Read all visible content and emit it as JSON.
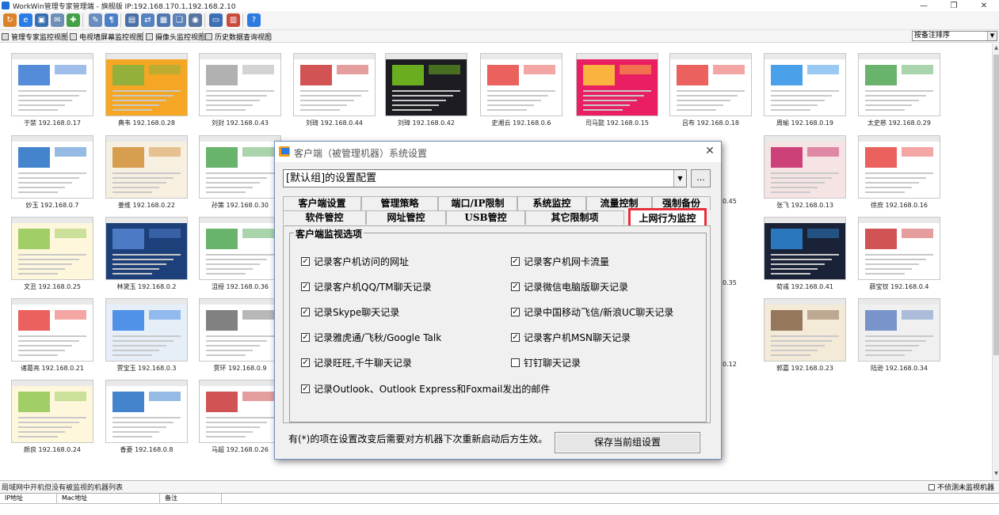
{
  "window": {
    "title": "WorkWin管理专家管理端 - 旗舰版 IP:192.168.170.1,192.168.2.10",
    "minimize": "—",
    "restore": "❐",
    "close": "✕"
  },
  "toolbar_icons": [
    {
      "name": "refresh-icon",
      "color": "#d9822b",
      "glyph": "↻"
    },
    {
      "name": "ie-browser-icon",
      "color": "#2a7be4",
      "glyph": "e"
    },
    {
      "name": "monitor-settings-icon",
      "color": "#3a6fb0",
      "glyph": "▣"
    },
    {
      "name": "mail-icon",
      "color": "#6d8fb5",
      "glyph": "✉"
    },
    {
      "name": "plugin-icon",
      "color": "#43a047",
      "glyph": "✚"
    },
    {
      "name": "wrench-icon",
      "color": "#6a8cc0",
      "glyph": "✎"
    },
    {
      "name": "policy-icon",
      "color": "#4a7fc7",
      "glyph": "¶"
    },
    {
      "name": "screen-icon",
      "color": "#4b6fa6",
      "glyph": "▤"
    },
    {
      "name": "network-icon",
      "color": "#5582c0",
      "glyph": "⇄"
    },
    {
      "name": "report-icon",
      "color": "#4f78b0",
      "glyph": "▦"
    },
    {
      "name": "copy-icon",
      "color": "#5b82b8",
      "glyph": "❏"
    },
    {
      "name": "disk-icon",
      "color": "#5973a0",
      "glyph": "◉"
    },
    {
      "name": "notepad-icon",
      "color": "#3d6fb6",
      "glyph": "▭"
    },
    {
      "name": "calendar-icon",
      "color": "#c94a3b",
      "glyph": "▥"
    },
    {
      "name": "help-icon",
      "color": "#2d7be0",
      "glyph": "?"
    }
  ],
  "view_tabs": [
    {
      "label": "管理专家监控视图"
    },
    {
      "label": "电视墙屏幕监控视图"
    },
    {
      "label": "摄像头监控视图"
    },
    {
      "label": "历史数据查询视图"
    }
  ],
  "sort_select": {
    "value": "按备注排序",
    "arrow": "▼"
  },
  "scrollbar": {
    "up": "▲",
    "down": "▼"
  },
  "thumbnails": [
    {
      "caption": "于禁 192.168.0.17",
      "theme": "#ffffff",
      "accent": "#2b6fd1"
    },
    {
      "caption": "典韦 192.168.0.28",
      "theme": "#f5a623",
      "accent": "#7cb342"
    },
    {
      "caption": "刘封 192.168.0.43",
      "theme": "#ffffff",
      "accent": "#9e9e9e"
    },
    {
      "caption": "刘琦 192.168.0.44",
      "theme": "#ffffff",
      "accent": "#c62828"
    },
    {
      "caption": "刘璋 192.168.0.42",
      "theme": "#1c1c22",
      "accent": "#7ed321"
    },
    {
      "caption": "史湘云 192.168.0.6",
      "theme": "#ffffff",
      "accent": "#e53935"
    },
    {
      "caption": "司马懿 192.168.0.15",
      "theme": "#e91e63",
      "accent": "#fdd835"
    },
    {
      "caption": "吕布 192.168.0.18",
      "theme": "#ffffff",
      "accent": "#e53935"
    },
    {
      "caption": "周瑜 192.168.0.19",
      "theme": "#ffffff",
      "accent": "#1e88e5"
    },
    {
      "caption": "太史慈 192.168.0.29",
      "theme": "#ffffff",
      "accent": "#43a047"
    },
    {
      "caption": "妙玉 192.168.0.7",
      "theme": "#ffffff",
      "accent": "#1565c0"
    },
    {
      "caption": "姜维 192.168.0.22",
      "theme": "#f7efe0",
      "accent": "#d08a2c"
    },
    {
      "caption": "孙策 192.168.0.30",
      "theme": "#ffffff",
      "accent": "#43a047"
    },
    {
      "caption": "张飞 192.168.0.13",
      "theme": "#f6e4e4",
      "accent": "#c2185b"
    },
    {
      "caption": "徐庶 192.168.0.16",
      "theme": "#ffffff",
      "accent": "#e53935"
    },
    {
      "caption": "文丑 192.168.0.25",
      "theme": "#fff7dc",
      "accent": "#8bc34a"
    },
    {
      "caption": "林黛玉 192.168.0.2",
      "theme": "#1d3f7a",
      "accent": "#5a8ad8"
    },
    {
      "caption": "沮授 192.168.0.36",
      "theme": "#ffffff",
      "accent": "#43a047"
    },
    {
      "caption": "荀彧 192.168.0.41",
      "theme": "#1a2238",
      "accent": "#2e8de0"
    },
    {
      "caption": "薛宝钗 192.168.0.4",
      "theme": "#ffffff",
      "accent": "#c62828"
    },
    {
      "caption": "诸葛亮 192.168.0.21",
      "theme": "#ffffff",
      "accent": "#e53935"
    },
    {
      "caption": "贾宝玉 192.168.0.3",
      "theme": "#e6eef8",
      "accent": "#2a7be4"
    },
    {
      "caption": "贾环 192.168.0.9",
      "theme": "#ffffff",
      "accent": "#616161"
    },
    {
      "caption": "郭嘉 192.168.0.23",
      "theme": "#f3ead8",
      "accent": "#7d5a3c"
    },
    {
      "caption": "陆逊 192.168.0.34",
      "theme": "#f0f0f0",
      "accent": "#5b7cc2"
    },
    {
      "caption": "颜良 192.168.0.24",
      "theme": "#fff7dc",
      "accent": "#8bc34a"
    },
    {
      "caption": "香菱 192.168.0.8",
      "theme": "#ffffff",
      "accent": "#1565c0"
    },
    {
      "caption": "马超 192.168.0.26",
      "theme": "#ffffff",
      "accent": "#c62828"
    }
  ],
  "partial_captions": [
    {
      "text": "0.45"
    },
    {
      "text": "0.35"
    },
    {
      "text": "0.12"
    }
  ],
  "dialog": {
    "title": "客户端（被管理机器）系统设置",
    "close": "✕",
    "config_value": "[默认组]的设置配置",
    "combo_arrow": "▼",
    "more_button": "...",
    "tabs_row1": [
      {
        "label": "客户端设置"
      },
      {
        "label": "管理策略"
      },
      {
        "label": "端口/IP限制"
      },
      {
        "label": "系统监控"
      },
      {
        "label": "流量控制"
      },
      {
        "label": "强制备份"
      }
    ],
    "tabs_row2": [
      {
        "label": "软件管控"
      },
      {
        "label": "网址管控"
      },
      {
        "label": "USB管控"
      },
      {
        "label": "其它限制项"
      },
      {
        "label": "上网行为监控"
      }
    ],
    "active_tab": "上网行为监控",
    "group_title": "客户端监视选项",
    "options_left": [
      {
        "label": "记录客户机访问的网址",
        "checked": true
      },
      {
        "label": "记录客户机QQ/TM聊天记录",
        "checked": true
      },
      {
        "label": "记录Skype聊天记录",
        "checked": true
      },
      {
        "label": "记录雅虎通/飞秋/Google Talk",
        "checked": true
      },
      {
        "label": "记录旺旺,千牛聊天记录",
        "checked": true
      }
    ],
    "options_right": [
      {
        "label": "记录客户机网卡流量",
        "checked": true
      },
      {
        "label": "记录微信电脑版聊天记录",
        "checked": true
      },
      {
        "label": "记录中国移动飞信/新浪UC聊天记录",
        "checked": true
      },
      {
        "label": "记录客户机MSN聊天记录",
        "checked": true
      },
      {
        "label": "钉钉聊天记录",
        "checked": false
      }
    ],
    "option_wide": {
      "label": "记录Outlook、Outlook Express和Foxmail发出的邮件",
      "checked": true
    },
    "check_mark": "✓",
    "note": "有(*)的项在设置改变后需要对方机器下次重新启动后方生效。",
    "save_button": "保存当前组设置",
    "highlight_color": "#e8303a"
  },
  "bottom_panel": {
    "title": "局域网中开机但没有被监视的机器列表",
    "filter_label": "不侦测未监视机器",
    "columns": [
      {
        "label": "IP地址"
      },
      {
        "label": "Mac地址"
      },
      {
        "label": "备注"
      },
      {
        "label": ""
      }
    ]
  }
}
